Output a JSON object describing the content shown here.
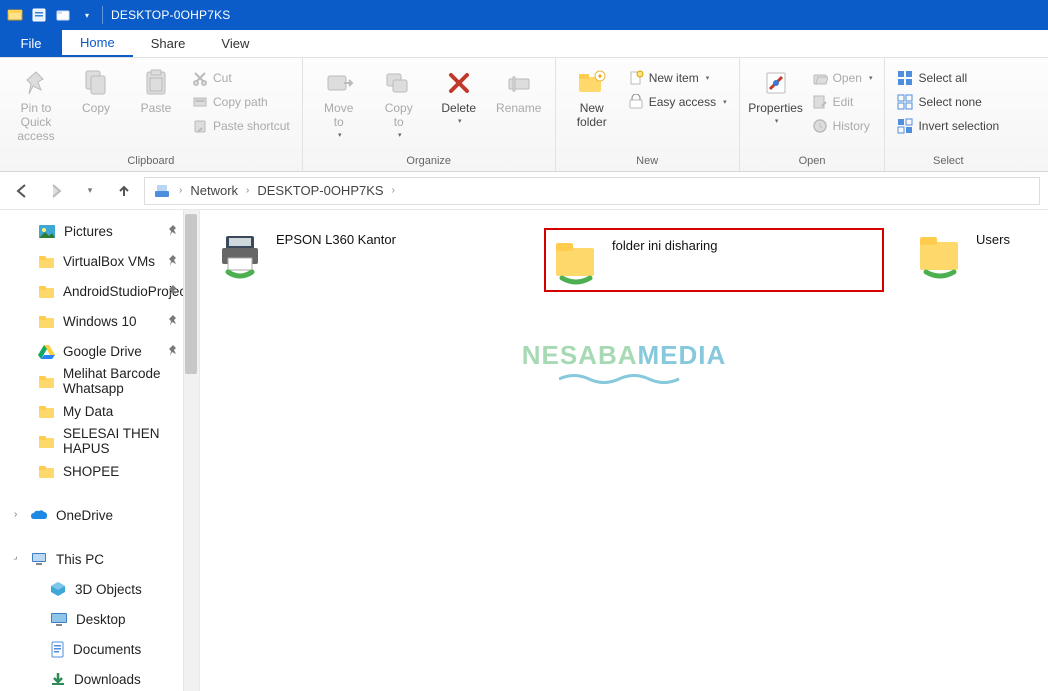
{
  "title": "DESKTOP-0OHP7KS",
  "tabs": {
    "file": "File",
    "home": "Home",
    "share": "Share",
    "view": "View"
  },
  "ribbon": {
    "clipboard": {
      "label": "Clipboard",
      "pin": "Pin to Quick\naccess",
      "copy": "Copy",
      "paste": "Paste",
      "cut": "Cut",
      "copy_path": "Copy path",
      "paste_shortcut": "Paste shortcut"
    },
    "organize": {
      "label": "Organize",
      "move_to": "Move\nto",
      "copy_to": "Copy\nto",
      "delete": "Delete",
      "rename": "Rename"
    },
    "new": {
      "label": "New",
      "new_folder": "New\nfolder",
      "new_item": "New item",
      "easy_access": "Easy access"
    },
    "open": {
      "label": "Open",
      "properties": "Properties",
      "open": "Open",
      "edit": "Edit",
      "history": "History"
    },
    "select": {
      "label": "Select",
      "all": "Select all",
      "none": "Select none",
      "invert": "Invert selection"
    }
  },
  "breadcrumb": {
    "root": "Network",
    "node": "DESKTOP-0OHP7KS"
  },
  "navpane": {
    "pinned": [
      {
        "label": "Pictures",
        "icon": "pictures"
      },
      {
        "label": "VirtualBox VMs",
        "icon": "folder"
      },
      {
        "label": "AndroidStudioProjects",
        "icon": "folder"
      },
      {
        "label": "Windows 10",
        "icon": "folder"
      },
      {
        "label": "Google Drive",
        "icon": "gdrive"
      },
      {
        "label": "Melihat Barcode Whatsapp",
        "icon": "folder"
      },
      {
        "label": "My Data",
        "icon": "folder"
      },
      {
        "label": "SELESAI THEN HAPUS",
        "icon": "folder"
      },
      {
        "label": "SHOPEE",
        "icon": "folder"
      }
    ],
    "onedrive": "OneDrive",
    "thispc": "This PC",
    "pcitems": [
      {
        "label": "3D Objects",
        "icon": "objects3d"
      },
      {
        "label": "Desktop",
        "icon": "desktop"
      },
      {
        "label": "Documents",
        "icon": "documents"
      },
      {
        "label": "Downloads",
        "icon": "downloads"
      }
    ]
  },
  "content": {
    "items": [
      {
        "name": "EPSON L360 Kantor",
        "type": "printer"
      },
      {
        "name": "folder ini disharing",
        "type": "shared-folder",
        "highlight": true
      },
      {
        "name": "Users",
        "type": "shared-folder"
      }
    ]
  },
  "watermark": {
    "a": "NESABA",
    "b": "MEDIA"
  }
}
